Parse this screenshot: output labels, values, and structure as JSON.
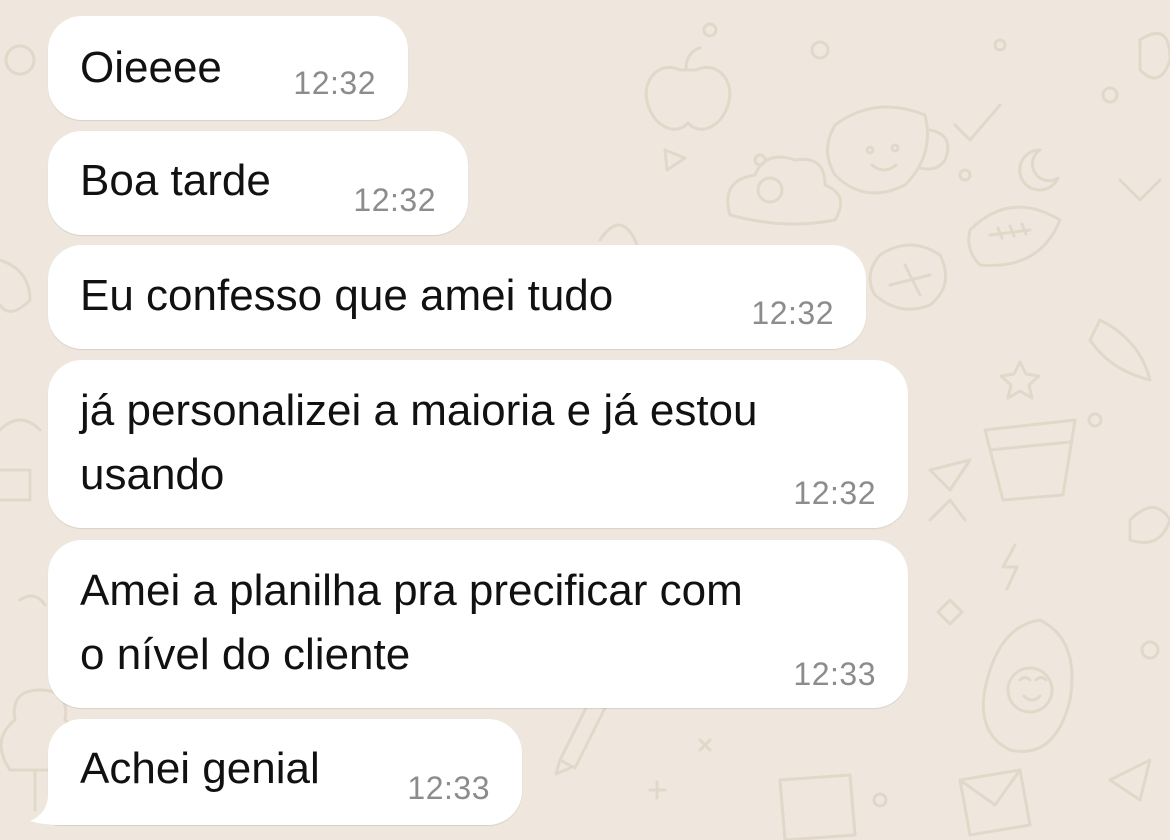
{
  "chat": {
    "messages": [
      {
        "text": "Oieeee",
        "time": "12:32"
      },
      {
        "text": "Boa tarde",
        "time": "12:32"
      },
      {
        "text": "Eu confesso que amei tudo",
        "time": "12:32"
      },
      {
        "lines": [
          "já personalizei a maioria e já estou",
          "usando"
        ],
        "time": "12:32"
      },
      {
        "lines": [
          "Amei a planilha pra precificar com",
          "o nível do cliente"
        ],
        "time": "12:33"
      },
      {
        "text": "Achei genial",
        "time": "12:33"
      }
    ]
  },
  "colors": {
    "wallpaper": "#efe7dd",
    "doodle": "#e2d8c9",
    "bubble": "#ffffff",
    "message_text": "#111111",
    "timestamp": "#8c8c8c"
  }
}
